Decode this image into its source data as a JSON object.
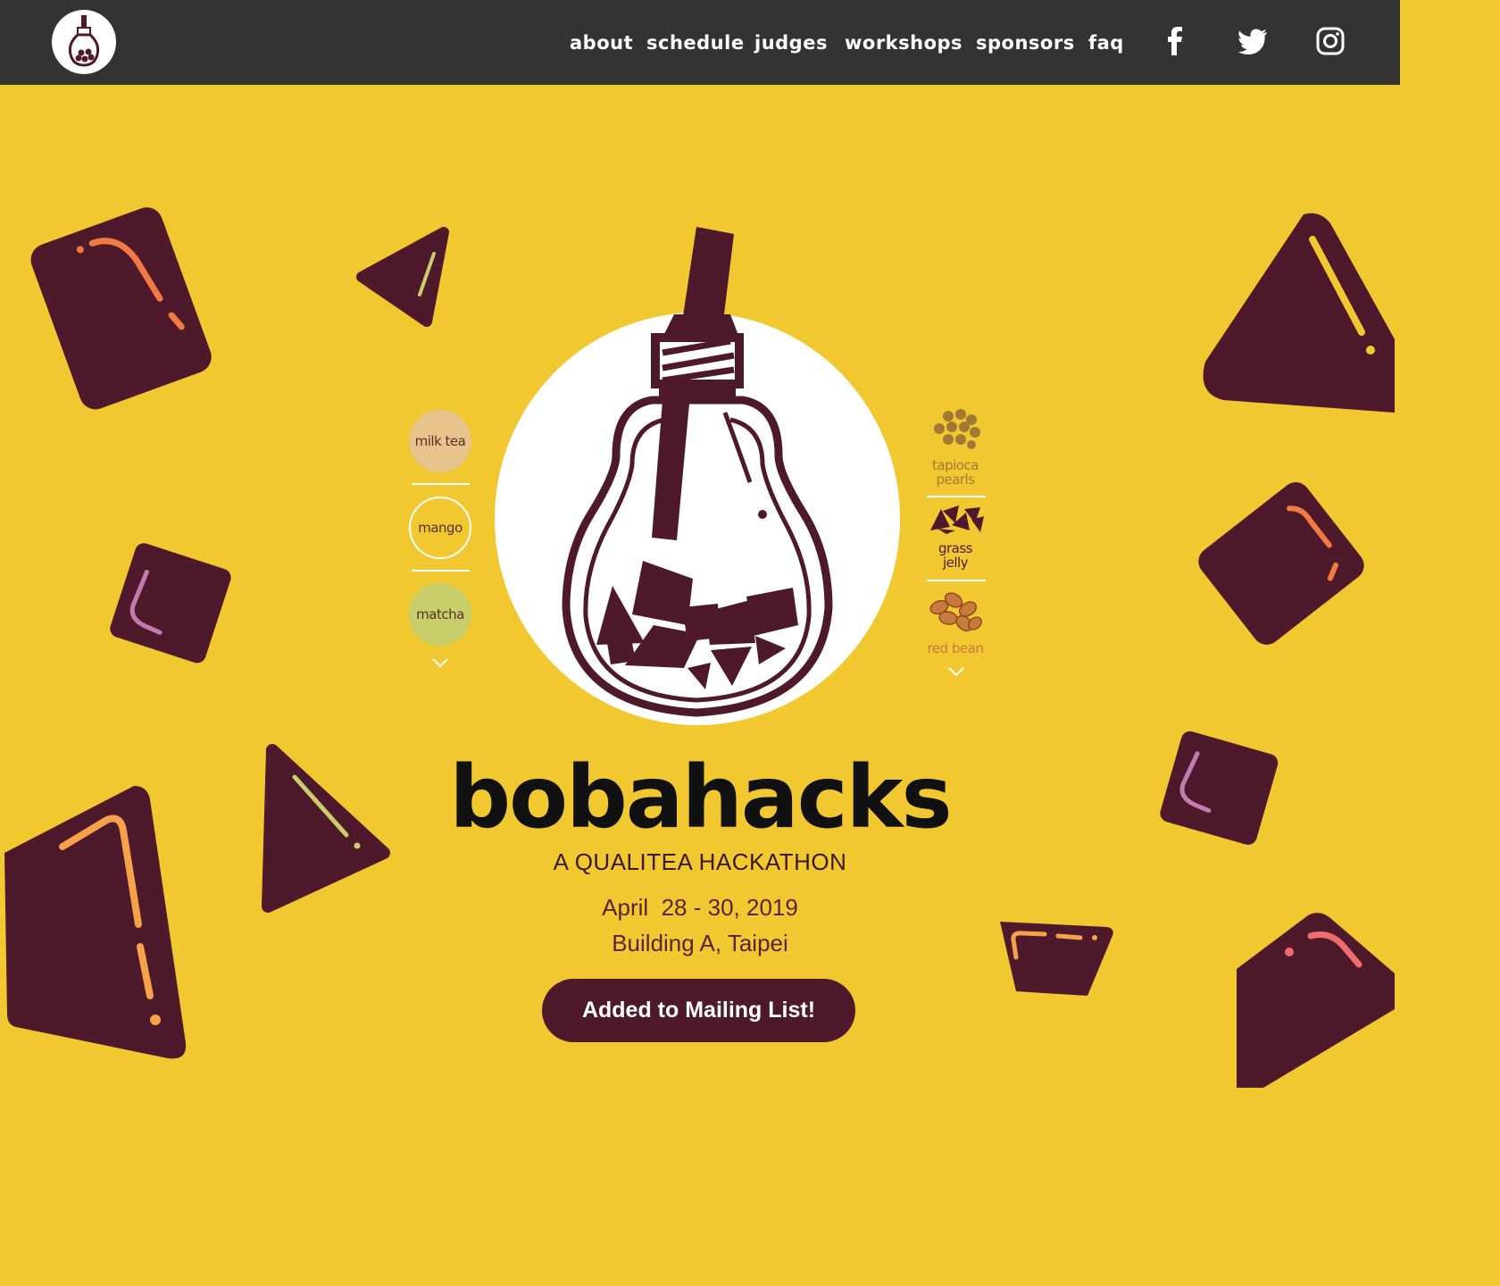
{
  "nav": {
    "logo_alt": "bobahacks logo",
    "links": [
      "about",
      "schedule",
      "judges",
      "workshops",
      "sponsors",
      "faq"
    ],
    "social": [
      "facebook-icon",
      "twitter-icon",
      "instagram-icon"
    ]
  },
  "flavors": {
    "items": [
      {
        "label": "milk tea",
        "color": "#E8C48D"
      },
      {
        "label": "mango",
        "color": "transparent"
      },
      {
        "label": "matcha",
        "color": "#C7CE6A"
      }
    ]
  },
  "toppings": {
    "items": [
      {
        "label": "tapioca\npearls",
        "color": "#A07A35"
      },
      {
        "label": "grass\njelly",
        "color": "#4E1A2B"
      },
      {
        "label": "red bean",
        "color": "#C97B3E"
      }
    ]
  },
  "hero": {
    "title": "bobahacks",
    "subtitle": "A QUALITEA HACKATHON",
    "date": "April  28 - 30, 2019",
    "location": "Building A, Taipei",
    "cta": "Added to Mailing List!"
  },
  "colors": {
    "background": "#F2C831",
    "nav": "#333333",
    "brand": "#4E1A2B"
  }
}
